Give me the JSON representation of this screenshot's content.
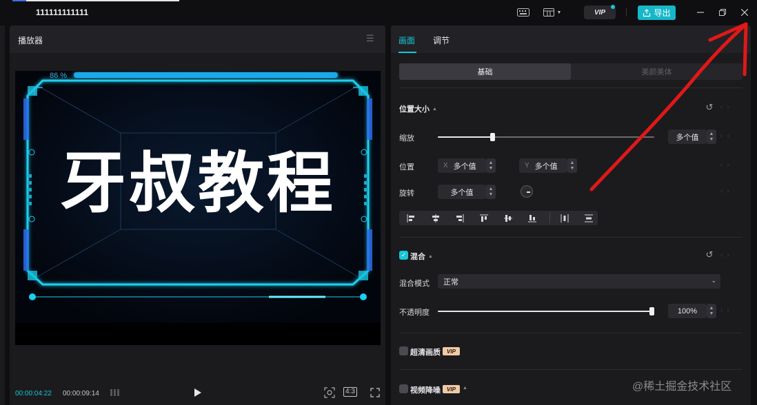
{
  "titlebar": {
    "project_name": "111111111111",
    "vip_label": "VIP",
    "export_label": "导出"
  },
  "player": {
    "title": "播放器",
    "preview": {
      "progress_text": "86 %",
      "caption": "牙叔教程"
    },
    "current_time": "00:00:04:22",
    "total_time": "00:00:09:14",
    "ratio_label": "4:3"
  },
  "inspector": {
    "tabs": [
      {
        "label": "画面",
        "active": true
      },
      {
        "label": "调节",
        "active": false
      }
    ],
    "segments": [
      {
        "label": "基础",
        "active": true
      },
      {
        "label": "美颜美体",
        "active": false
      }
    ],
    "position_section": {
      "title": "位置大小",
      "scale_label": "缩放",
      "scale_value": "多个值",
      "scale_fraction": 0.25,
      "position_label": "位置",
      "x_prefix": "X",
      "x_value": "多个值",
      "y_prefix": "Y",
      "y_value": "多个值",
      "rotation_label": "旋转",
      "rotation_value": "多个值"
    },
    "blend_section": {
      "title": "混合",
      "checked": true,
      "mode_label": "混合模式",
      "mode_value": "正常",
      "opacity_label": "不透明度",
      "opacity_value": "100%",
      "opacity_fraction": 1.0
    },
    "hd_section": {
      "title": "超清画质",
      "vip_label": "VIP",
      "checked": false
    },
    "denoise_section": {
      "title": "视频降噪",
      "vip_label": "VIP",
      "checked": false
    }
  },
  "watermark": "@稀土掘金技术社区",
  "colors": {
    "accent": "#18c6d6",
    "annotation": "#e01818"
  }
}
